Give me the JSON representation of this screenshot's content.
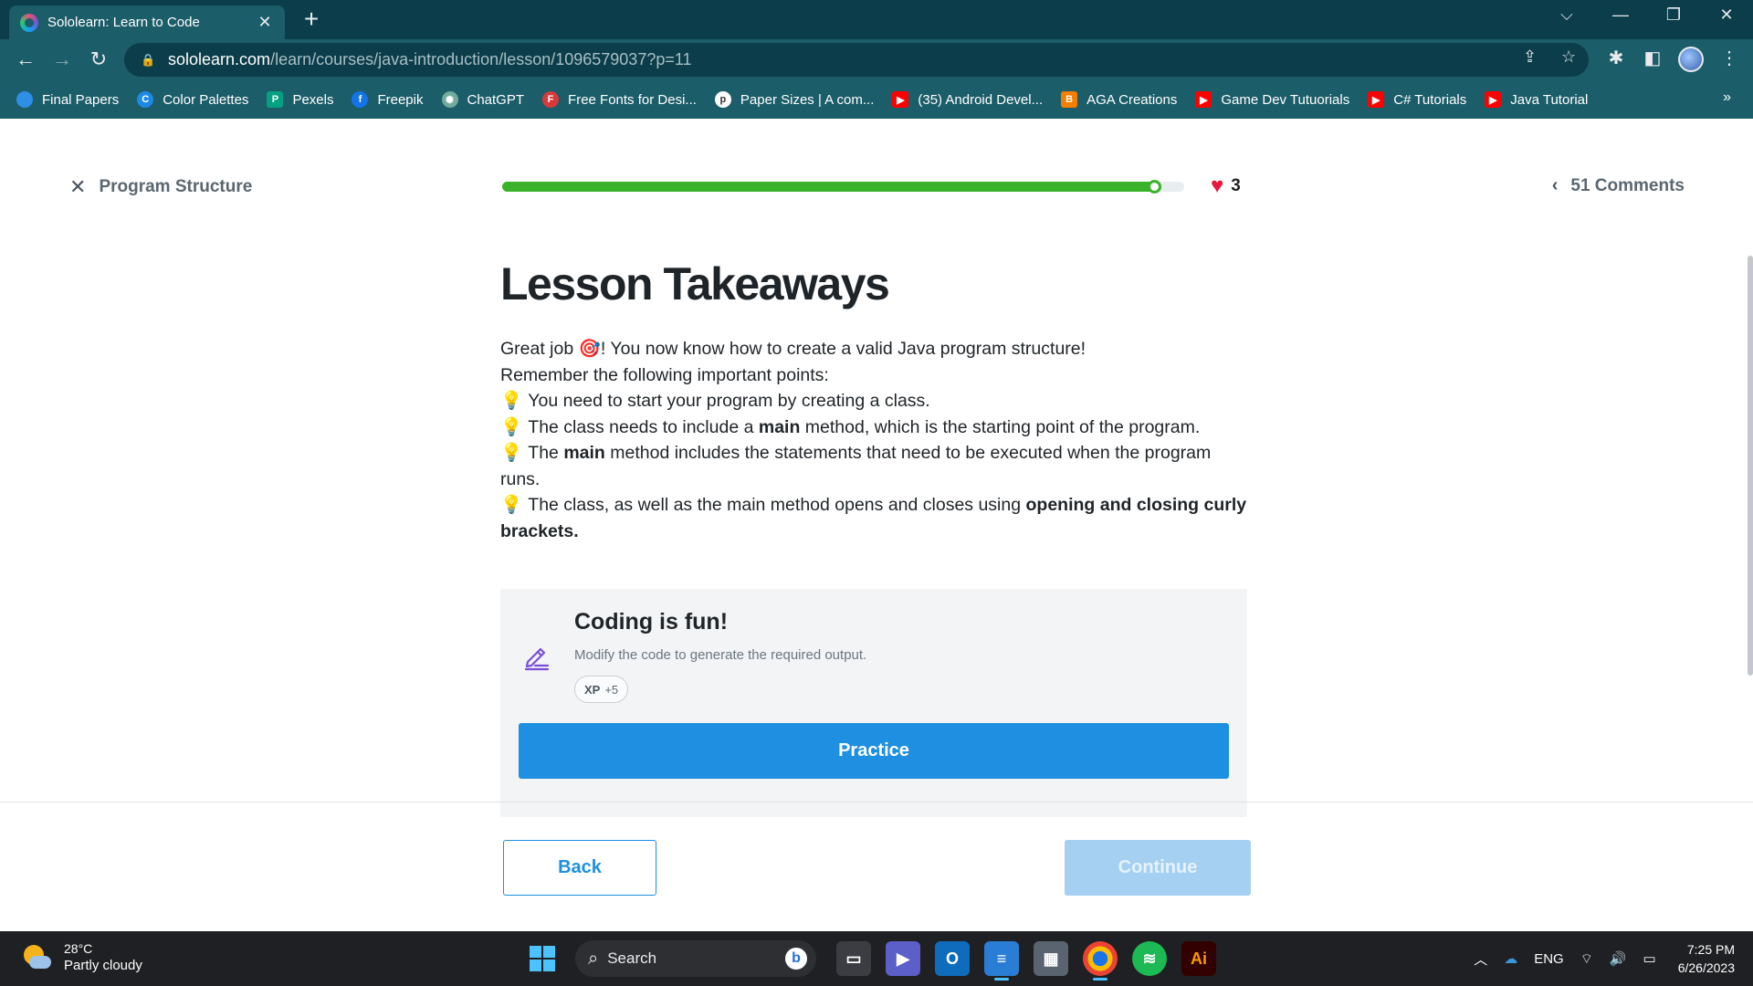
{
  "browser": {
    "tab_title": "Sololearn: Learn to Code",
    "url_host": "sololearn.com",
    "url_path": "/learn/courses/java-introduction/lesson/1096579037?p=11",
    "bookmarks": [
      {
        "label": "Final Papers",
        "icon": "cloud-icon",
        "color": "#2f8ee5"
      },
      {
        "label": "Color Palettes",
        "icon": "color-palettes-icon",
        "color": "#1e88e5"
      },
      {
        "label": "Pexels",
        "icon": "pexels-icon",
        "color": "#05a081"
      },
      {
        "label": "Freepik",
        "icon": "freepik-icon",
        "color": "#1273eb"
      },
      {
        "label": "ChatGPT",
        "icon": "chatgpt-icon",
        "color": "#74aa9c"
      },
      {
        "label": "Free Fonts for Desi...",
        "icon": "fonts-icon",
        "color": "#d83a3a"
      },
      {
        "label": "Paper Sizes | A com...",
        "icon": "paper-sizes-icon",
        "color": "#ffffff"
      },
      {
        "label": "(35) Android Devel...",
        "icon": "youtube-icon",
        "color": "#ff0000"
      },
      {
        "label": "AGA Creations",
        "icon": "blogger-icon",
        "color": "#f57d00"
      },
      {
        "label": "Game Dev Tutuorials",
        "icon": "youtube-icon",
        "color": "#ff0000"
      },
      {
        "label": "C# Tutorials",
        "icon": "youtube-icon",
        "color": "#ff0000"
      },
      {
        "label": "Java Tutorial",
        "icon": "youtube-icon",
        "color": "#ff0000"
      }
    ],
    "bookmarks_overflow": "»"
  },
  "lesson": {
    "close_label": "Program Structure",
    "progress": 0.96,
    "hearts": "3",
    "comments_label": "51 Comments",
    "title": "Lesson Takeaways",
    "intro_before": "Great job ",
    "intro_after": "! You now know how to create a valid Java program structure!",
    "remember": "Remember the following important points:",
    "point1": "You need to start your program by creating a class.",
    "point2_a": "The class needs to include a ",
    "point2_b": "main",
    "point2_c": " method, which is the starting point of the program.",
    "point3_a": "The ",
    "point3_b": "main",
    "point3_c": " method includes the statements that need to be executed when the program runs.",
    "point4_a": "The class, as well as the main method opens and closes using ",
    "point4_b": "opening and closing curly brackets."
  },
  "practice_card": {
    "title": "Coding is fun!",
    "subtitle": "Modify the code to generate the required output.",
    "xp_label": "XP",
    "xp_value": "+5",
    "button": "Practice"
  },
  "footer": {
    "back": "Back",
    "continue": "Continue"
  },
  "taskbar": {
    "temp": "28°C",
    "condition": "Partly cloudy",
    "search": "Search",
    "language": "ENG",
    "time": "7:25 PM",
    "date": "6/26/2023"
  },
  "colors": {
    "accent": "#1e8fe1",
    "progress": "#3ab32a",
    "heart": "#e8173c",
    "chrome": "#1b5d69"
  }
}
